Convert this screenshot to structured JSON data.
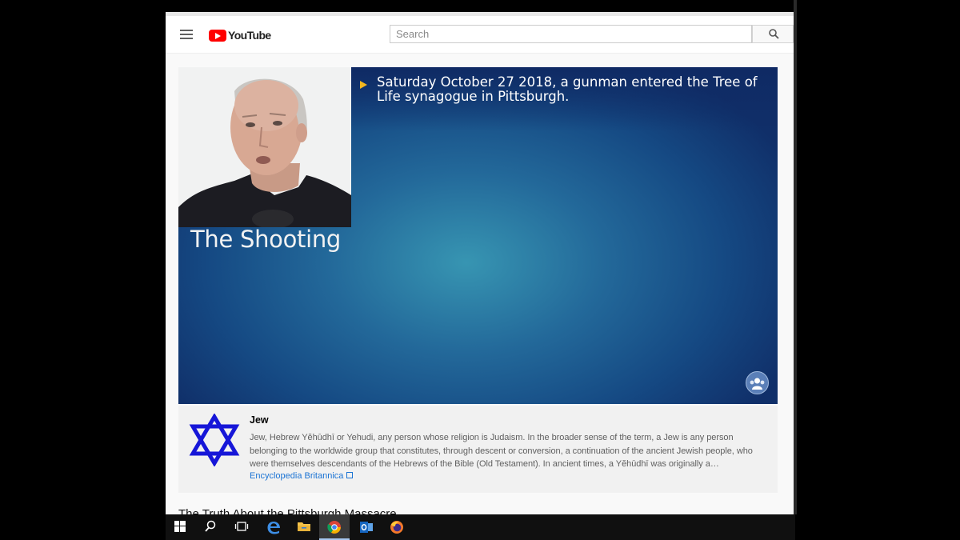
{
  "header": {
    "logo_text": "YouTube",
    "search_placeholder": "Search"
  },
  "video": {
    "bullet_text": "Saturday October 27 2018, a gunman entered the Tree of Life synagogue in Pittsburgh.",
    "slide_title": "The Shooting"
  },
  "info_panel": {
    "title": "Jew",
    "body": "Jew, Hebrew Yĕhūdhī or Yehudi, any person whose religion is Judaism. In the broader sense of the term, a Jew is any person belonging to the worldwide group that constitutes, through descent or conversion, a continuation of the ancient Jewish people, who were themselves descendants of the Hebrews of the Bible (Old Testament). In ancient times, a Yĕhūdhī was originally a…",
    "source_link": "Encyclopedia Britannica",
    "icon": "star-of-david-icon",
    "icon_color": "#1616d8"
  },
  "below_video_title": "The Truth About the Pittsburgh Massacre",
  "taskbar": {
    "items": [
      "windows-start-icon",
      "search-icon",
      "task-view-icon",
      "edge-browser-icon",
      "file-explorer-icon",
      "chrome-browser-icon",
      "outlook-icon",
      "firefox-browser-icon"
    ]
  },
  "colors": {
    "youtube_red": "#ff0000",
    "bullet_yellow": "#f3b71f",
    "slide_blue": "#1c5a93",
    "link_blue": "#1a73d4"
  }
}
